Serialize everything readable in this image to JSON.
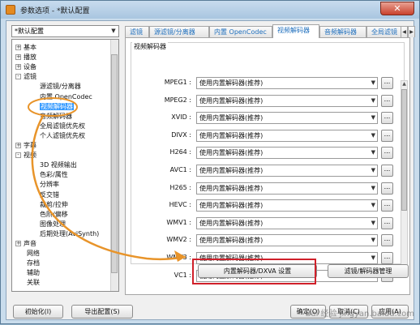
{
  "window": {
    "title": "参数选项 - *默认配置",
    "close_glyph": "✕"
  },
  "preset": {
    "value": "*默认配置"
  },
  "tree": {
    "items": [
      {
        "label": "基本",
        "exp": "+"
      },
      {
        "label": "播放",
        "exp": "+"
      },
      {
        "label": "设备",
        "exp": "+"
      },
      {
        "label": "滤镜",
        "exp": "-"
      },
      {
        "label": "源滤镜/分离器",
        "exp": ""
      },
      {
        "label": "内置 OpenCodec",
        "exp": ""
      },
      {
        "label": "视频解码器",
        "exp": "",
        "selected": true
      },
      {
        "label": "音频解码器",
        "exp": ""
      },
      {
        "label": "全局滤镜优先权",
        "exp": ""
      },
      {
        "label": "个人滤镜优先权",
        "exp": ""
      },
      {
        "label": "字幕",
        "exp": "+"
      },
      {
        "label": "视频",
        "exp": "-"
      },
      {
        "label": "3D 视频输出",
        "exp": ""
      },
      {
        "label": "色彩/属性",
        "exp": ""
      },
      {
        "label": "分辨率",
        "exp": ""
      },
      {
        "label": "反交错",
        "exp": ""
      },
      {
        "label": "裁剪/拉伸",
        "exp": ""
      },
      {
        "label": "色阶/偏移",
        "exp": ""
      },
      {
        "label": "图像处理",
        "exp": ""
      },
      {
        "label": "后期处理(AviSynth)",
        "exp": ""
      },
      {
        "label": "声音",
        "exp": "+"
      },
      {
        "label": "网络",
        "exp": ""
      },
      {
        "label": "存档",
        "exp": ""
      },
      {
        "label": "辅助",
        "exp": ""
      },
      {
        "label": "关联",
        "exp": ""
      }
    ]
  },
  "tabs": [
    {
      "label": "滤镜"
    },
    {
      "label": "源滤镜/分离器"
    },
    {
      "label": "内置 OpenCodec"
    },
    {
      "label": "视频解码器",
      "active": true
    },
    {
      "label": "音频解码器"
    },
    {
      "label": "全局滤镜"
    }
  ],
  "tab_scroll": {
    "left": "◀",
    "right": "▶"
  },
  "decoders": {
    "group_title": "视频解码器",
    "rows": [
      {
        "label": "MPEG1 :",
        "value": "使用内置解码器(推荐)"
      },
      {
        "label": "MPEG2 :",
        "value": "使用内置解码器(推荐)"
      },
      {
        "label": "XVID :",
        "value": "使用内置解码器(推荐)"
      },
      {
        "label": "DIVX :",
        "value": "使用内置解码器(推荐)"
      },
      {
        "label": "H264 :",
        "value": "使用内置解码器(推荐)"
      },
      {
        "label": "AVC1 :",
        "value": "使用内置解码器(推荐)"
      },
      {
        "label": "H265 :",
        "value": "使用内置解码器(推荐)"
      },
      {
        "label": "HEVC :",
        "value": "使用内置解码器(推荐)"
      },
      {
        "label": "WMV1 :",
        "value": "使用内置解码器(推荐)"
      },
      {
        "label": "WMV2 :",
        "value": "使用内置解码器(推荐)"
      },
      {
        "label": "WMV3 :",
        "value": "使用内置解码器(推荐)"
      },
      {
        "label": "VC1 :",
        "value": "使用内置解码器(推荐)"
      }
    ],
    "dots": "...",
    "dropdown_arrow": "▼"
  },
  "buttons": {
    "dxva": "内置解码器/DXVA 设置",
    "filter_mgr": "滤镜/解码器管理",
    "init": "初始化(I)",
    "export": "导出配置(S)",
    "ok": "确定(O)",
    "cancel": "取消(C)",
    "apply": "应用(A)"
  },
  "watermark": "Bai 经验 jingyan.baidu.com",
  "colors": {
    "selection": "#3399ff",
    "highlight_box": "#d0202a",
    "annotation_arrow": "#e8942a",
    "tab_text": "#1f6fbd"
  }
}
